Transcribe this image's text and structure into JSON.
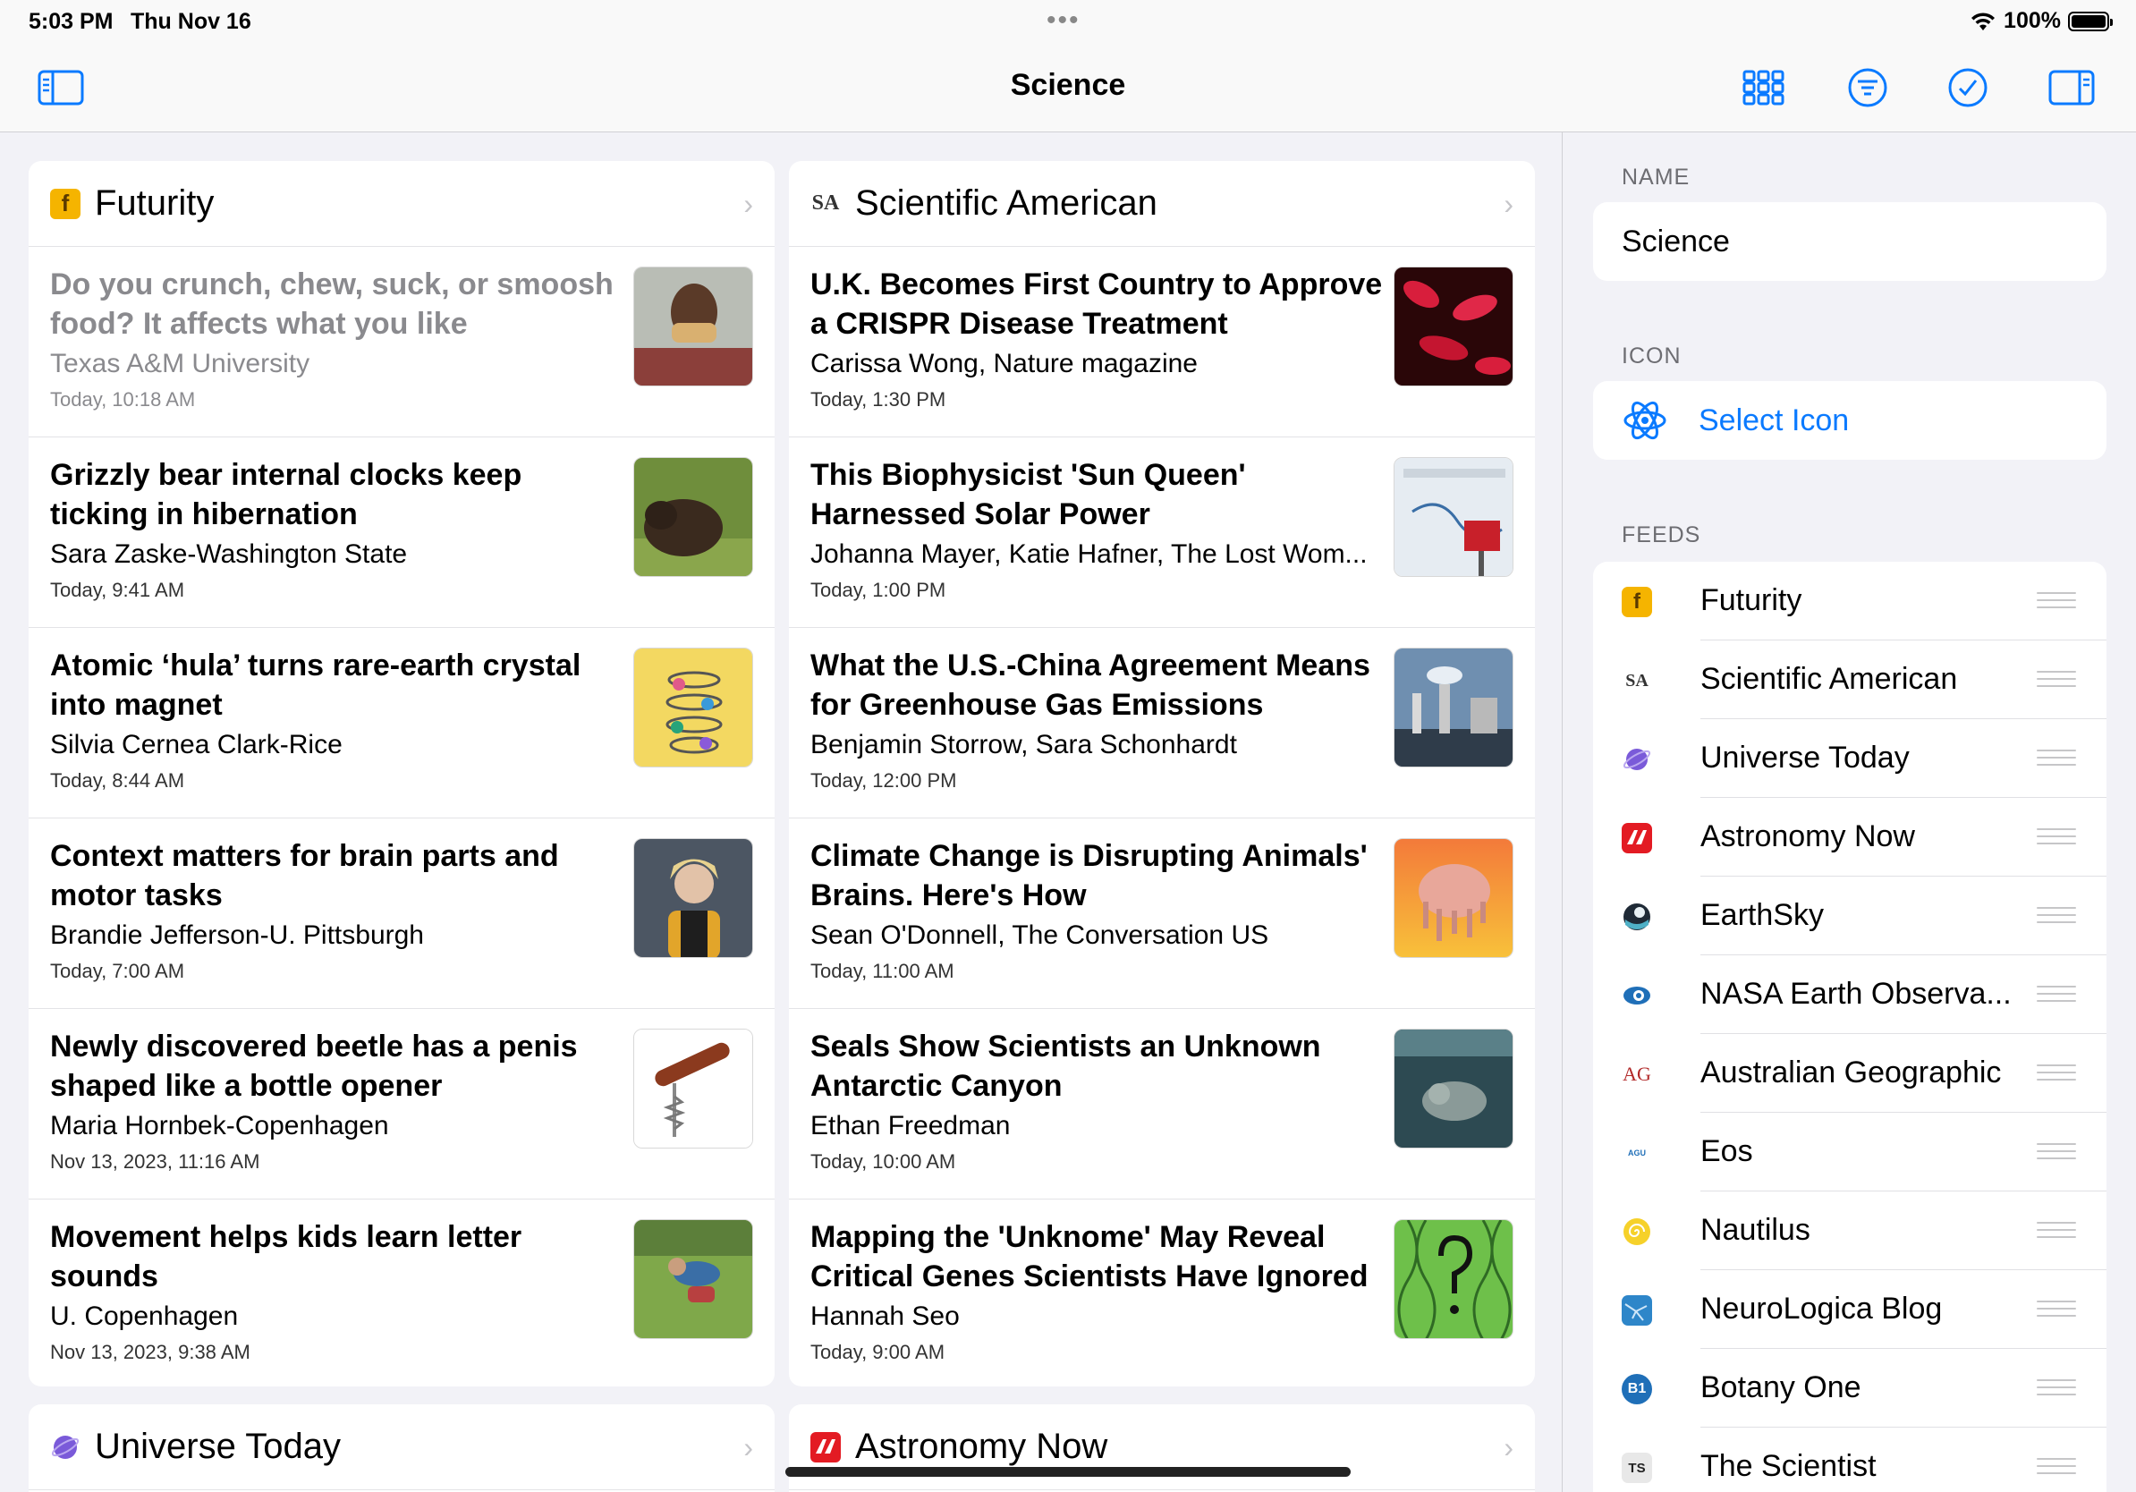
{
  "status": {
    "time": "5:03 PM",
    "date": "Thu Nov 16",
    "battery": "100%",
    "battery_fill": 1.0
  },
  "nav": {
    "title": "Science"
  },
  "columns": [
    {
      "feed": "Futurity",
      "articles": [
        {
          "title": "Do you crunch, chew, suck, or smoosh food? It affects what you like",
          "author": "Texas A&M University",
          "date": "Today, 10:18 AM",
          "read": true,
          "thumb": "person-eating"
        },
        {
          "title": "Grizzly bear internal clocks keep ticking in hibernation",
          "author": "Sara Zaske-Washington State",
          "date": "Today, 9:41 AM",
          "read": false,
          "thumb": "bear"
        },
        {
          "title": "Atomic ‘hula’ turns rare-earth crystal into magnet",
          "author": "Silvia Cernea Clark-Rice",
          "date": "Today, 8:44 AM",
          "read": false,
          "thumb": "beads-spiral"
        },
        {
          "title": "Context matters for brain parts and motor tasks",
          "author": "Brandie Jefferson-U. Pittsburgh",
          "date": "Today, 7:00 AM",
          "read": false,
          "thumb": "woman-portrait"
        },
        {
          "title": "Newly discovered beetle has a penis shaped like a bottle opener",
          "author": "Maria Hornbek-Copenhagen",
          "date": "Nov 13, 2023, 11:16 AM",
          "read": false,
          "thumb": "corkscrew"
        },
        {
          "title": "Movement helps kids learn letter sounds",
          "author": "U. Copenhagen",
          "date": "Nov 13, 2023, 9:38 AM",
          "read": false,
          "thumb": "kids-grass"
        }
      ]
    },
    {
      "feed": "Scientific American",
      "articles": [
        {
          "title": "U.K. Becomes First Country to Approve a CRISPR Disease Treatment",
          "author": "Carissa Wong, Nature magazine",
          "date": "Today, 1:30 PM",
          "read": false,
          "thumb": "red-cells"
        },
        {
          "title": "This Biophysicist 'Sun Queen' Harnessed Solar Power",
          "author": "Johanna Mayer, Katie Hafner, The Lost Wom...",
          "date": "Today, 1:00 PM",
          "read": false,
          "thumb": "from-our-inbox"
        },
        {
          "title": "What the U.S.-China Agreement Means for Greenhouse Gas Emissions",
          "author": "Benjamin Storrow, Sara Schonhardt",
          "date": "Today, 12:00 PM",
          "read": false,
          "thumb": "power-plant"
        },
        {
          "title": "Climate Change is Disrupting Animals' Brains. Here's How",
          "author": "Sean O'Donnell, The Conversation US",
          "date": "Today, 11:00 AM",
          "read": false,
          "thumb": "melting-brain"
        },
        {
          "title": "Seals Show Scientists an Unknown Antarctic Canyon",
          "author": "Ethan Freedman",
          "date": "Today, 10:00 AM",
          "read": false,
          "thumb": "seal-underwater"
        },
        {
          "title": "Mapping the 'Unknome' May Reveal Critical Genes Scientists Have Ignored",
          "author": "Hannah Seo",
          "date": "Today, 9:00 AM",
          "read": false,
          "thumb": "dna-question"
        }
      ]
    }
  ],
  "bottom_cards": [
    "Universe Today",
    "Astronomy Now"
  ],
  "sidebar": {
    "name_label": "NAME",
    "name_value": "Science",
    "icon_label": "ICON",
    "select_icon": "Select Icon",
    "feeds_label": "FEEDS",
    "feeds": [
      {
        "name": "Futurity",
        "icon": "futurity-icon"
      },
      {
        "name": "Scientific American",
        "icon": "sa-icon"
      },
      {
        "name": "Universe Today",
        "icon": "universe-today-icon"
      },
      {
        "name": "Astronomy Now",
        "icon": "astronomy-now-icon"
      },
      {
        "name": "EarthSky",
        "icon": "earthsky-icon"
      },
      {
        "name": "NASA Earth Observa...",
        "icon": "nasa-earth-icon"
      },
      {
        "name": "Australian Geographic",
        "icon": "ag-icon"
      },
      {
        "name": "Eos",
        "icon": "eos-icon"
      },
      {
        "name": "Nautilus",
        "icon": "nautilus-icon"
      },
      {
        "name": "NeuroLogica Blog",
        "icon": "neurologica-icon"
      },
      {
        "name": "Botany One",
        "icon": "botany-one-icon"
      },
      {
        "name": "The Scientist",
        "icon": "the-scientist-icon"
      }
    ]
  },
  "icon_glyphs": {
    "futurity": "f",
    "sa": "SA",
    "ag": "AG",
    "eos": "AGU",
    "botany": "B1",
    "scientist": "TS"
  },
  "colors": {
    "accent": "#0a7aff",
    "futurity": "#f5b400",
    "astronomy_now": "#e31b23"
  }
}
